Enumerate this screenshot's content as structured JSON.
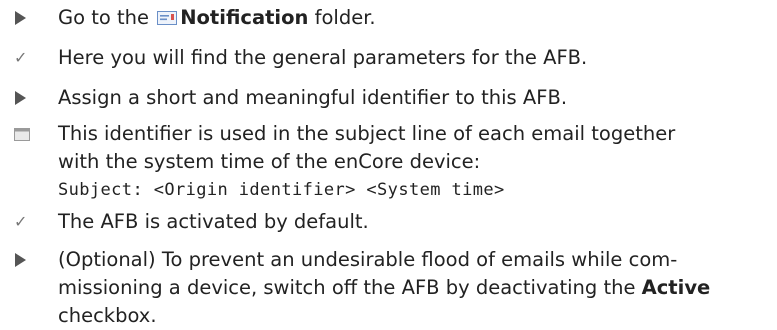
{
  "items": [
    {
      "type": "action",
      "pre": "Go to the ",
      "bold": "Notification",
      "post": " folder."
    },
    {
      "type": "result",
      "text": "Here you will find the general parameters for the AFB."
    },
    {
      "type": "action",
      "text": "Assign a short and meaningful identifier to this AFB."
    },
    {
      "type": "note",
      "line1": "This identifier is used in the subject line of each email together",
      "line2": "with the system time of the enCore device:",
      "code": "Subject: <Origin identifier> <System time>"
    },
    {
      "type": "result",
      "text": "The AFB is activated by default."
    },
    {
      "type": "action",
      "line1": "(Optional) To prevent an undesirable flood of emails while com-",
      "line2_pre": "missioning a device, switch off the AFB by deactivating the ",
      "line2_bold": "Active",
      "line3": "checkbox."
    }
  ],
  "colors": {
    "text": "#222222",
    "marker": "#555555",
    "check": "#777777",
    "folder_red": "#d9534f",
    "folder_blue": "#6a8fc7"
  },
  "icons": {
    "action": "triangle-right-icon",
    "result": "checkmark-icon",
    "note": "note-icon",
    "folder": "folder-icon"
  }
}
